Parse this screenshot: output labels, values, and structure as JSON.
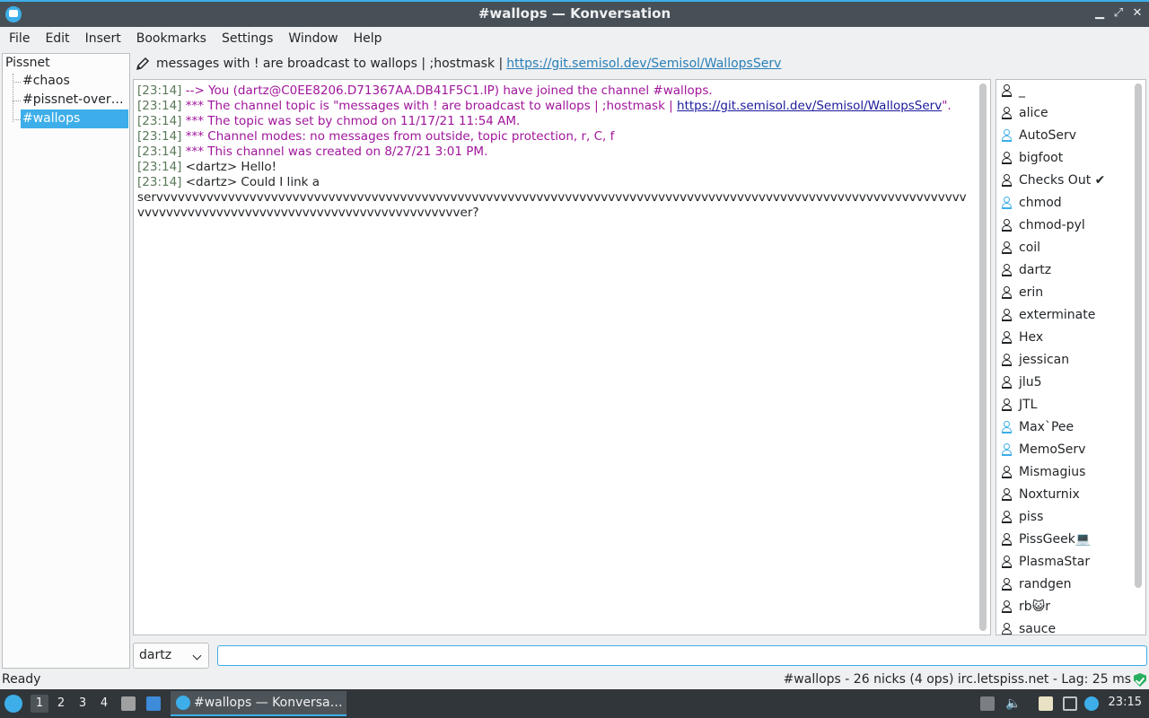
{
  "window": {
    "title": "#wallops — Konversation"
  },
  "menu": [
    "File",
    "Edit",
    "Insert",
    "Bookmarks",
    "Settings",
    "Window",
    "Help"
  ],
  "tree": {
    "server": "Pissnet",
    "channels": [
      "#chaos",
      "#pissnet-over…",
      "#wallops"
    ],
    "selected": "#wallops"
  },
  "topic": {
    "text": "messages with ! are broadcast to wallops | ;hostmask |",
    "link": "https://git.semisol.dev/Semisol/WallopsServ"
  },
  "messages": [
    {
      "ts": "[23:14]",
      "text": "--> You (dartz@C0EE8206.D71367AA.DB41F5C1.IP) have joined the channel #wallops.",
      "kind": "sys"
    },
    {
      "ts": "[23:14]",
      "text": "*** The channel topic is \"messages with ! are broadcast to wallops | ;hostmask |",
      "link": "https://git.semisol.dev/Semisol/WallopsServ",
      "suffix": "\".",
      "kind": "sys"
    },
    {
      "ts": "[23:14]",
      "text": "*** The topic was set by chmod on 11/17/21 11:54 AM.",
      "kind": "sys"
    },
    {
      "ts": "[23:14]",
      "text": "*** Channel modes: no messages from outside, topic protection, r, C, f",
      "kind": "sys"
    },
    {
      "ts": "[23:14]",
      "text": "*** This channel was created on 8/27/21 3:01 PM.",
      "kind": "sys"
    },
    {
      "ts": "[23:14]",
      "text": "<dartz> Hello!",
      "kind": "msg"
    },
    {
      "ts": "[23:14]",
      "text": "<dartz> Could I link a",
      "kind": "msg"
    }
  ],
  "long_message": "servvvvvvvvvvvvvvvvvvvvvvvvvvvvvvvvvvvvvvvvvvvvvvvvvvvvvvvvvvvvvvvvvvvvvvvvvvvvvvvvvvvvvvvvvvvvvvvvvvvvvvvvvvvvvvvvvvvvvvvvvvvvvvvvvvvvvvvvvvvvvvvvvvvvvvvvvvvvvver?",
  "nicks": [
    {
      "name": "_",
      "op": false
    },
    {
      "name": "alice",
      "op": false
    },
    {
      "name": "AutoServ",
      "op": true
    },
    {
      "name": "bigfoot",
      "op": false
    },
    {
      "name": "Checks Out ✔",
      "op": false
    },
    {
      "name": "chmod",
      "op": true
    },
    {
      "name": "chmod-pyl",
      "op": false
    },
    {
      "name": "coil",
      "op": false
    },
    {
      "name": "dartz",
      "op": false
    },
    {
      "name": "erin",
      "op": false
    },
    {
      "name": "exterminate",
      "op": false
    },
    {
      "name": "Hex",
      "op": false
    },
    {
      "name": "jessican",
      "op": false
    },
    {
      "name": "jlu5",
      "op": false
    },
    {
      "name": "JTL",
      "op": false
    },
    {
      "name": "Max`Pee",
      "op": true
    },
    {
      "name": "MemoServ",
      "op": true
    },
    {
      "name": "Mismagius",
      "op": false
    },
    {
      "name": "Noxturnix",
      "op": false
    },
    {
      "name": "piss",
      "op": false
    },
    {
      "name": "PissGeek💻",
      "op": false
    },
    {
      "name": "PlasmaStar",
      "op": false
    },
    {
      "name": "randgen",
      "op": false
    },
    {
      "name": "rb😺r",
      "op": false
    },
    {
      "name": "sauce",
      "op": false
    }
  ],
  "input": {
    "nick": "dartz",
    "value": ""
  },
  "status": {
    "left": "Ready",
    "right": "#wallops - 26 nicks (4 ops)  irc.letspiss.net - Lag: 25 ms"
  },
  "taskbar": {
    "desktops": [
      "1",
      "2",
      "3",
      "4"
    ],
    "active_desktop": "1",
    "task": "#wallops — Konversa…",
    "clock": "23:15"
  },
  "colors": {
    "accent": "#3daee9",
    "system_text": "#a0159b",
    "timestamp": "#5a7a5a",
    "link": "#2980b9"
  }
}
